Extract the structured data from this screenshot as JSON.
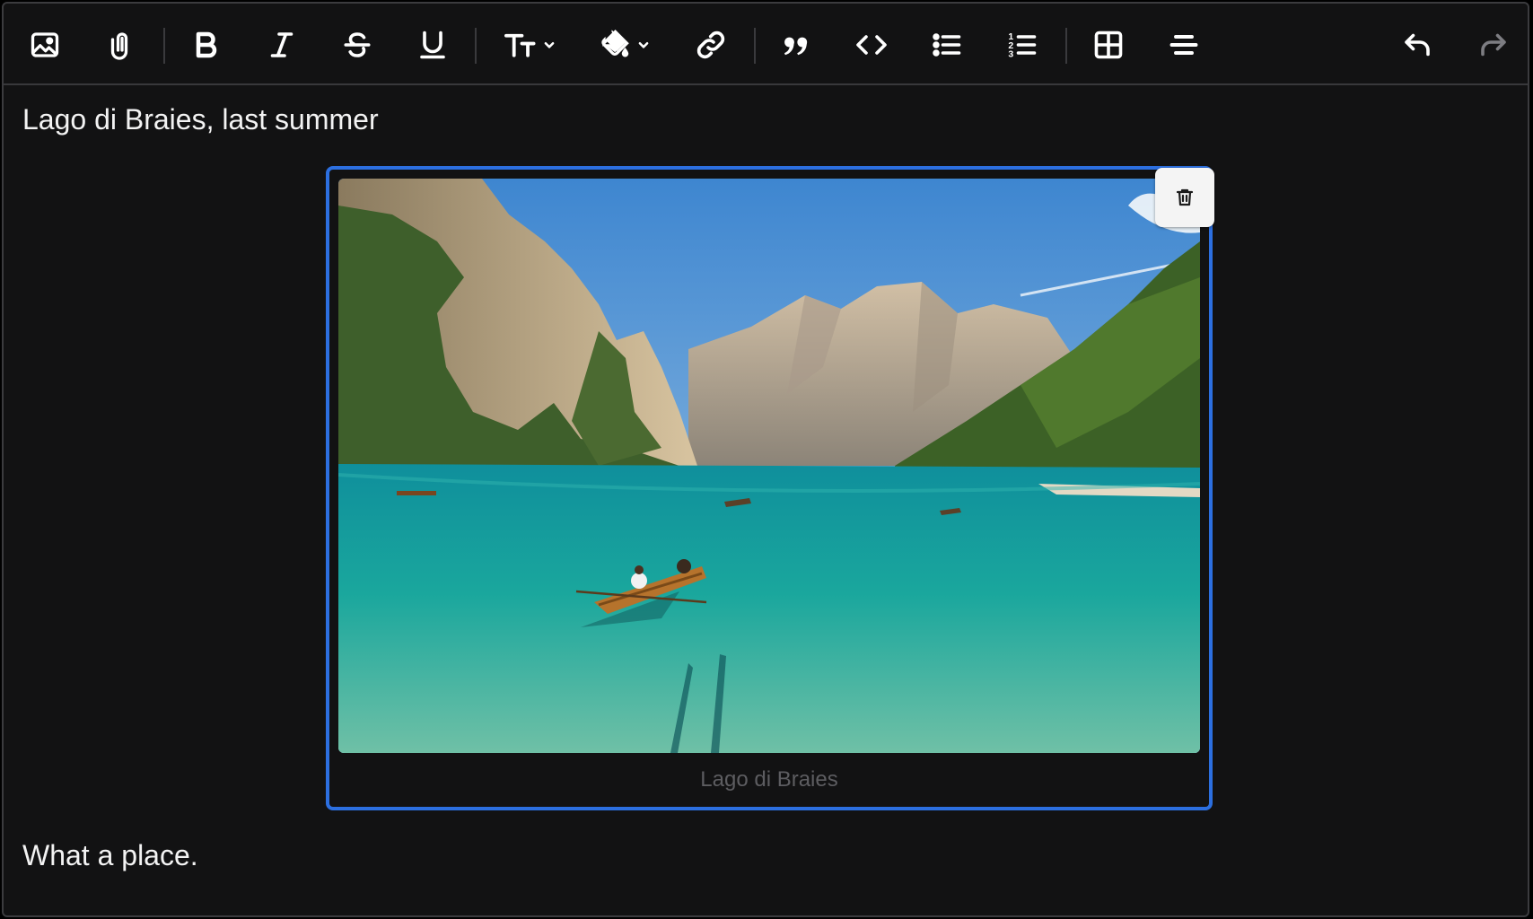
{
  "toolbar": {
    "buttons": [
      {
        "name": "insert-image-button",
        "icon": "image-icon"
      },
      {
        "name": "attach-file-button",
        "icon": "paperclip-icon"
      },
      {
        "name": "bold-button",
        "icon": "bold-icon"
      },
      {
        "name": "italic-button",
        "icon": "italic-icon"
      },
      {
        "name": "strikethrough-button",
        "icon": "strikethrough-icon"
      },
      {
        "name": "underline-button",
        "icon": "underline-icon"
      },
      {
        "name": "text-size-button",
        "icon": "text-size-icon"
      },
      {
        "name": "fill-color-button",
        "icon": "paint-bucket-icon"
      },
      {
        "name": "link-button",
        "icon": "link-icon"
      },
      {
        "name": "blockquote-button",
        "icon": "quote-icon"
      },
      {
        "name": "code-button",
        "icon": "code-icon"
      },
      {
        "name": "bullet-list-button",
        "icon": "bullet-list-icon"
      },
      {
        "name": "numbered-list-button",
        "icon": "numbered-list-icon"
      },
      {
        "name": "table-button",
        "icon": "table-icon"
      },
      {
        "name": "align-center-button",
        "icon": "align-center-icon"
      },
      {
        "name": "undo-button",
        "icon": "undo-icon"
      },
      {
        "name": "redo-button",
        "icon": "redo-icon",
        "disabled": true
      }
    ],
    "numbered_list_glyphs": [
      "1",
      "2",
      "3"
    ]
  },
  "content": {
    "first_paragraph": "Lago di Braies, last summer",
    "image_caption": "Lago di Braies",
    "last_paragraph": "What a place."
  },
  "colors": {
    "background": "#121213",
    "selection_border": "#2c6fe0",
    "caption_text": "#5d5d61",
    "text": "#f3f3f3"
  }
}
